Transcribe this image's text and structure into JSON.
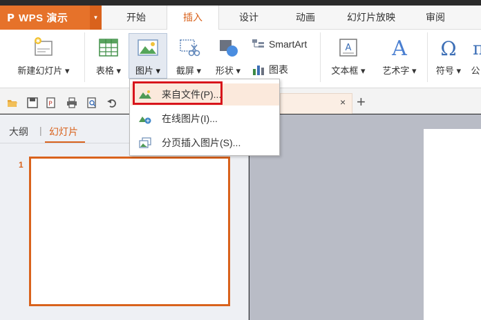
{
  "app": {
    "logo": "P",
    "name": "WPS 演示",
    "logo_icon": "wps-p-icon"
  },
  "tabs": [
    {
      "label": "开始"
    },
    {
      "label": "插入",
      "active": true
    },
    {
      "label": "设计"
    },
    {
      "label": "动画"
    },
    {
      "label": "幻灯片放映"
    },
    {
      "label": "审阅"
    }
  ],
  "ribbon": {
    "new_slide": "新建幻灯片 ▾",
    "table": "表格 ▾",
    "picture": "图片 ▾",
    "screenshot": "截屏 ▾",
    "shapes": "形状 ▾",
    "smartart": "SmartArt",
    "chart": "图表",
    "textbox": "文本框 ▾",
    "wordart": "艺术字 ▾",
    "symbol": "符号 ▾",
    "formula_partial": "公"
  },
  "picture_menu": {
    "items": [
      {
        "label": "来自文件(P)...",
        "icon": "picture-file-icon"
      },
      {
        "label": "在线图片(I)...",
        "icon": "online-picture-icon"
      },
      {
        "label": "分页插入图片(S)...",
        "icon": "paged-picture-icon"
      }
    ]
  },
  "doc_tab": {
    "close": "×",
    "new": "+"
  },
  "left_pane": {
    "outline_tab": "大纲",
    "separator": "|",
    "slides_tab": "幻灯片",
    "slide_number": "1"
  },
  "colors": {
    "accent": "#d9621c",
    "highlight_box": "#d8141b",
    "menu_hover": "#fbe9dc"
  }
}
